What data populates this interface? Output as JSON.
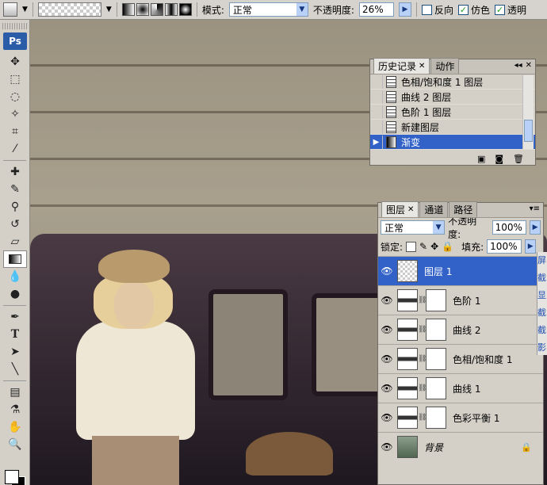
{
  "options_bar": {
    "mode_label": "模式:",
    "mode_value": "正常",
    "opacity_label": "不透明度:",
    "opacity_value": "26%",
    "reverse_label": "反向",
    "dither_label": "仿色",
    "transparency_label": "透明"
  },
  "tools": {
    "logo": "Ps"
  },
  "history": {
    "tabs": [
      "历史记录",
      "动作"
    ],
    "items": [
      {
        "label": "色相/饱和度 1 图层"
      },
      {
        "label": "曲线 2 图层"
      },
      {
        "label": "色阶 1 图层"
      },
      {
        "label": "新建图层"
      },
      {
        "label": "渐变",
        "selected": true
      }
    ]
  },
  "layers": {
    "tabs": [
      "图层",
      "通道",
      "路径"
    ],
    "blend_mode": "正常",
    "opacity_label": "不透明度:",
    "opacity_value": "100%",
    "lock_label": "锁定:",
    "fill_label": "填充:",
    "fill_value": "100%",
    "items": [
      {
        "name": "图层 1",
        "selected": true
      },
      {
        "name": "色阶 1"
      },
      {
        "name": "曲线 2"
      },
      {
        "name": "色相/饱和度 1"
      },
      {
        "name": "曲线 1"
      },
      {
        "name": "色彩平衡 1"
      },
      {
        "name": "背景"
      }
    ]
  },
  "side_strip": [
    "屏",
    "截",
    "显",
    "截",
    "截",
    "影"
  ]
}
